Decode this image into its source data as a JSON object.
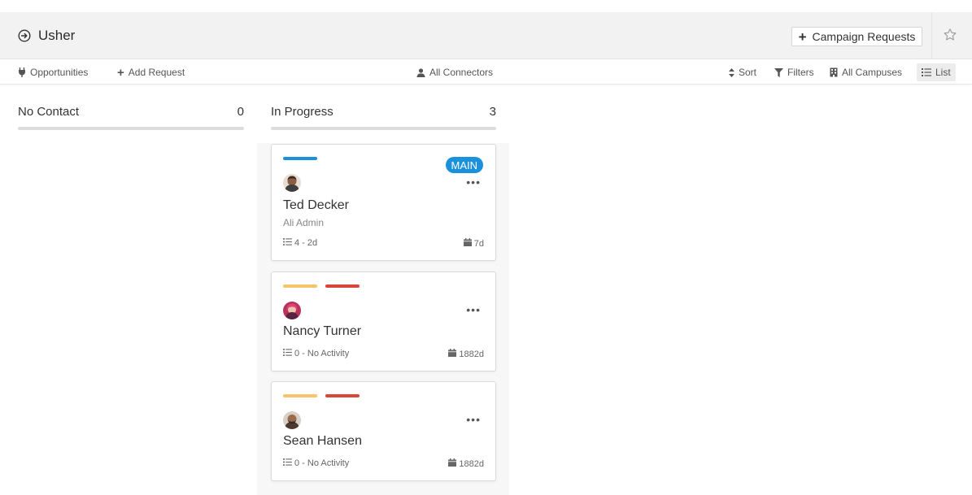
{
  "header": {
    "title": "Usher",
    "campaign_button_label": "Campaign Requests"
  },
  "toolbar": {
    "opportunities": "Opportunities",
    "add_request": "Add Request",
    "connectors": "All Connectors",
    "sort": "Sort",
    "filters": "Filters",
    "campuses": "All Campuses",
    "list": "List"
  },
  "columns": [
    {
      "title": "No Contact",
      "count": "0"
    },
    {
      "title": "In Progress",
      "count": "3"
    }
  ],
  "cards": [
    {
      "name": "Ted Decker",
      "subtitle": "Ali Admin",
      "badge": "MAIN",
      "activity": "4 - 2d",
      "age": "7d",
      "tags": [
        "#1a91da"
      ],
      "avatar_color": "#6b4a3a"
    },
    {
      "name": "Nancy Turner",
      "subtitle": "",
      "badge": "",
      "activity": "0 - No Activity",
      "age": "1882d",
      "tags": [
        "#f6c56b",
        "#d9473a"
      ],
      "avatar_color": "#c2325a"
    },
    {
      "name": "Sean Hansen",
      "subtitle": "",
      "badge": "",
      "activity": "0 - No Activity",
      "age": "1882d",
      "tags": [
        "#f6c56b",
        "#d9473a"
      ],
      "avatar_color": "#7a5540"
    }
  ],
  "colors": {
    "accent": "#1a91da",
    "tag_yellow": "#f6c56b",
    "tag_red": "#d9473a"
  },
  "icons": [
    "arrow-circle-icon",
    "plus-icon",
    "star-icon",
    "plug-icon",
    "user-icon",
    "sort-icon",
    "filter-icon",
    "building-icon",
    "list-icon",
    "more-icon",
    "calendar-icon"
  ]
}
